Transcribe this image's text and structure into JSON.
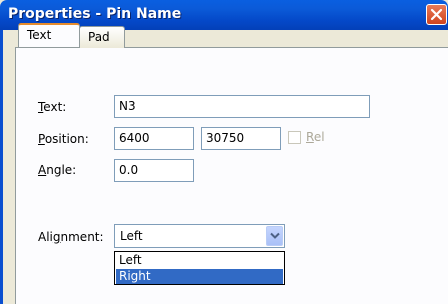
{
  "window": {
    "title": "Properties - Pin Name",
    "accent": "#0a5fe0"
  },
  "tabs": [
    {
      "label": "Text",
      "active": true
    },
    {
      "label": "Pad",
      "active": false
    }
  ],
  "form": {
    "text_label": "ext:",
    "text_label_mnemonic": "T",
    "text_value": "N3",
    "position_label": "osition:",
    "position_label_mnemonic": "P",
    "position_x": "6400",
    "position_y": "30750",
    "rel_label": "el",
    "rel_label_mnemonic": "R",
    "angle_label": "ngle:",
    "angle_label_mnemonic": "A",
    "angle_value": "0.0",
    "alignment_label_pre": "Ali",
    "alignment_label_mnemonic": "g",
    "alignment_label_post": "nment:",
    "alignment_value": "Left",
    "alignment_options": [
      "Left",
      "Right"
    ],
    "alignment_highlighted": "Right"
  },
  "icons": {
    "close": "close-icon",
    "dropdown": "chevron-down-icon"
  }
}
